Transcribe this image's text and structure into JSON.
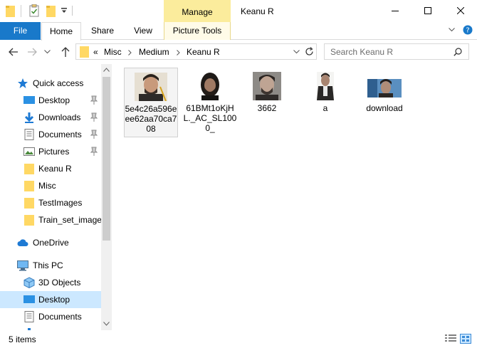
{
  "window": {
    "title": "Keanu R",
    "context_tab": "Manage"
  },
  "ribbon": {
    "tabs": [
      "File",
      "Home",
      "Share",
      "View",
      "Picture Tools"
    ]
  },
  "address": {
    "overflow": "«",
    "crumbs": [
      "Misc",
      "Medium",
      "Keanu R"
    ],
    "search_placeholder": "Search Keanu R"
  },
  "nav": {
    "quick_access": "Quick access",
    "items": [
      {
        "label": "Desktop",
        "pinned": true
      },
      {
        "label": "Downloads",
        "pinned": true
      },
      {
        "label": "Documents",
        "pinned": true
      },
      {
        "label": "Pictures",
        "pinned": true
      },
      {
        "label": "Keanu R",
        "pinned": false
      },
      {
        "label": "Misc",
        "pinned": false
      },
      {
        "label": "TestImages",
        "pinned": false
      },
      {
        "label": "Train_set_images",
        "pinned": false
      }
    ],
    "onedrive": "OneDrive",
    "this_pc": "This PC",
    "pc_items": [
      "3D Objects",
      "Desktop",
      "Documents"
    ]
  },
  "files": [
    {
      "name": "5e4c26a596eee62aa70ca708",
      "selected": true
    },
    {
      "name": "61BMt1oKjHL._AC_SL1000_",
      "selected": false
    },
    {
      "name": "3662",
      "selected": false
    },
    {
      "name": "a",
      "selected": false
    },
    {
      "name": "download",
      "selected": false
    }
  ],
  "status": {
    "count": "5 items"
  },
  "colors": {
    "accent": "#1979ca",
    "manage_highlight": "#fbec9c",
    "selection": "#cce8ff",
    "folder": "#ffd864"
  }
}
